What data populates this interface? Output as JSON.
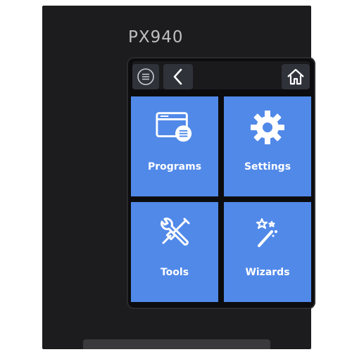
{
  "device": {
    "model": "PX940"
  },
  "topbar": {
    "menu_icon": "menu-circle-icon",
    "back_icon": "chevron-left-icon",
    "home_icon": "home-icon"
  },
  "tiles": [
    {
      "label": "Programs",
      "icon": "programs-window-icon"
    },
    {
      "label": "Settings",
      "icon": "gear-icon"
    },
    {
      "label": "Tools",
      "icon": "wrench-screwdriver-icon"
    },
    {
      "label": "Wizards",
      "icon": "magic-wand-icon"
    }
  ],
  "colors": {
    "tile": "#5189e9",
    "bezel": "#1c1c1e",
    "icon": "#ffffff"
  }
}
